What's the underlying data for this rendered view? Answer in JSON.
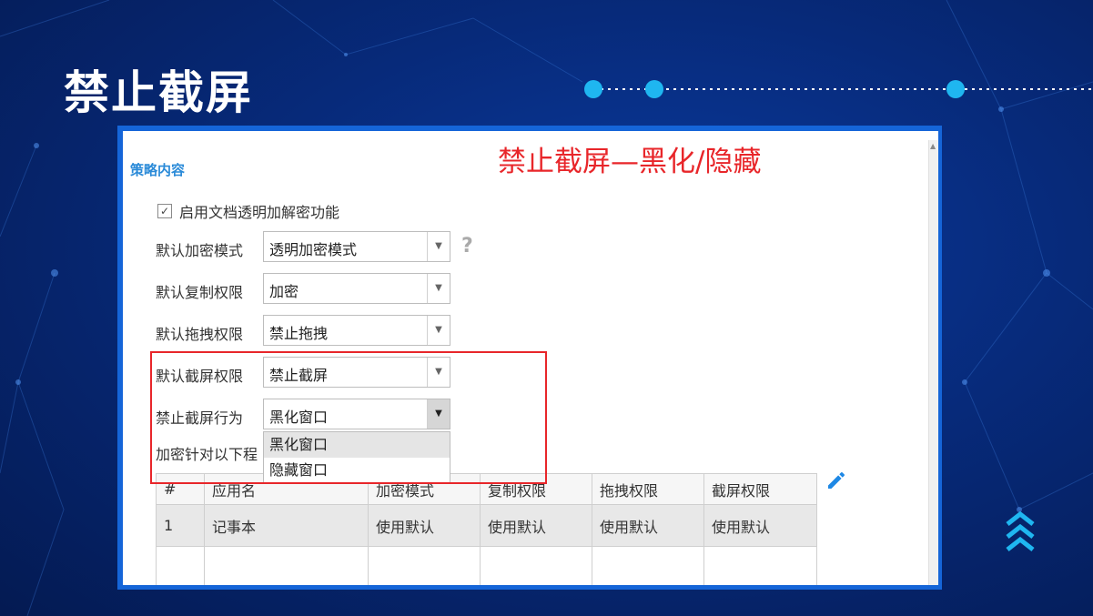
{
  "slide": {
    "title": "禁止截屏",
    "colors": {
      "background": "#072a7a",
      "panel_frame": "#1565d8",
      "accent_red": "#e8262a",
      "accent_cyan": "#1fb6f0"
    }
  },
  "overlay": {
    "caption": "禁止截屏—黑化/隐藏"
  },
  "panel": {
    "section_title": "策略内容",
    "enable_checkbox": {
      "label": "启用文档透明加解密功能",
      "checked": true
    },
    "fields": {
      "encrypt_mode": {
        "label": "默认加密模式",
        "value": "透明加密模式"
      },
      "copy_perm": {
        "label": "默认复制权限",
        "value": "加密"
      },
      "drag_perm": {
        "label": "默认拖拽权限",
        "value": "禁止拖拽"
      },
      "screenshot_perm": {
        "label": "默认截屏权限",
        "value": "禁止截屏"
      },
      "screenshot_action": {
        "label": "禁止截屏行为",
        "value": "黑化窗口",
        "options": [
          "黑化窗口",
          "隐藏窗口"
        ]
      }
    },
    "help_icon": "question-icon",
    "table_label": "加密针对以下程",
    "table": {
      "headers": [
        "#",
        "应用名",
        "加密模式",
        "复制权限",
        "拖拽权限",
        "截屏权限"
      ],
      "rows": [
        [
          "1",
          "记事本",
          "使用默认",
          "使用默认",
          "使用默认",
          "使用默认"
        ]
      ]
    },
    "edit_icon": "pencil-icon"
  }
}
